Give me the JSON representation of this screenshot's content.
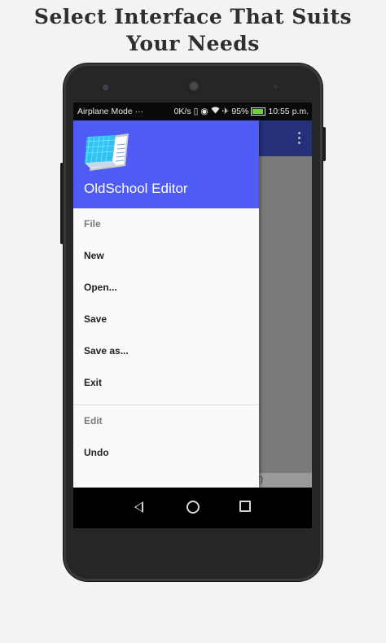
{
  "headline": {
    "line1": "Select Interface That Suits",
    "line2": "Your Needs"
  },
  "status_bar": {
    "mode": "Airplane Mode",
    "dots": "···",
    "net_speed": "0K/s",
    "battery_percent": "95%",
    "time": "10:55 p.m."
  },
  "drawer": {
    "app_title": "OldSchool Editor",
    "sections": [
      {
        "label": "File",
        "items": [
          "New",
          "Open...",
          "Save",
          "Save as...",
          "Exit"
        ]
      },
      {
        "label": "Edit",
        "items": [
          "Undo"
        ]
      }
    ]
  },
  "behind_content": {
    "bottom_text": "F)"
  },
  "icons": {
    "app_bar_menu": "overflow-vertical-icon",
    "nav_back": "back-icon",
    "nav_home": "home-icon",
    "nav_recent": "recent-apps-icon"
  },
  "colors": {
    "drawer_header": "#4e5cf5",
    "app_bar": "#24307a",
    "page_background": "#f3f3f3"
  }
}
